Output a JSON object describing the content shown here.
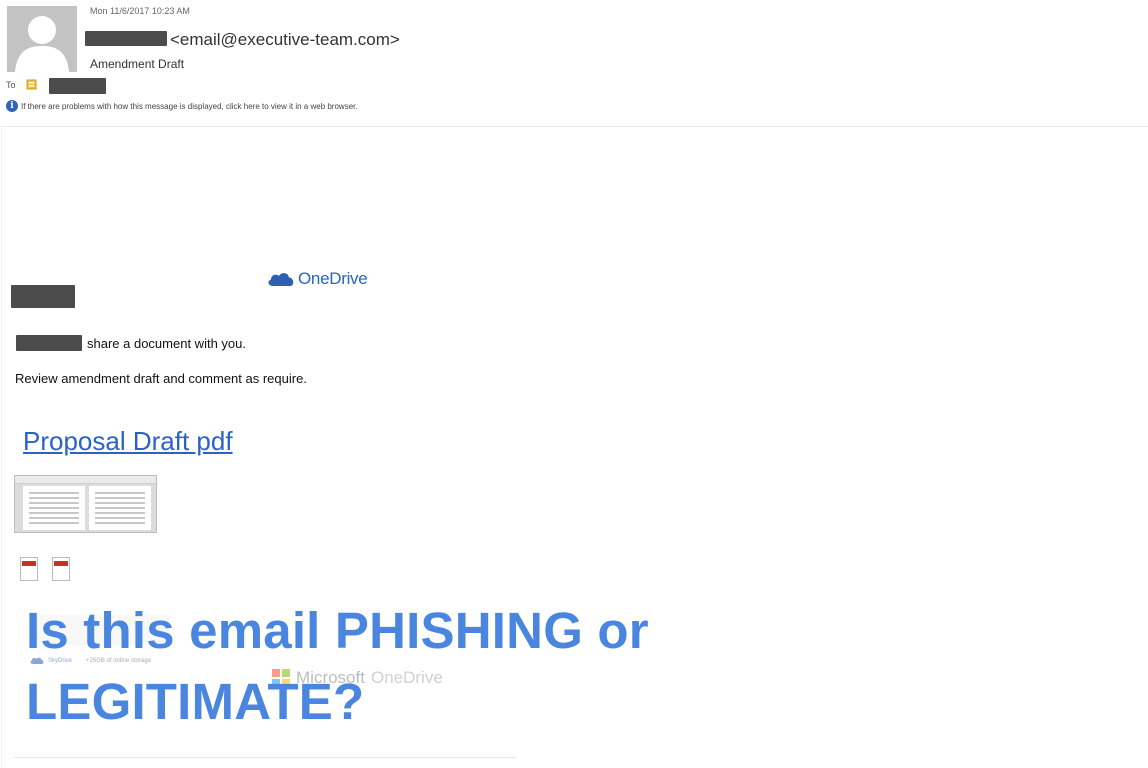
{
  "header": {
    "datetime": "Mon 11/6/2017 10:23 AM",
    "sender_email": "<email@executive-team.com>",
    "subject": "Amendment Draft",
    "to_label": "To",
    "info_text": "If there are problems with how this message is displayed, click here to view it in a web browser."
  },
  "body": {
    "brand": "OneDrive",
    "share_text": "share a document with you.",
    "instruction": "Review amendment draft and comment as require.",
    "document_link": "Proposal Draft pdf"
  },
  "footer": {
    "brand_small": "SkyDrive",
    "storage_text": "+25GB of online storage",
    "microsoft": "Microsoft",
    "onedrive": "OneDrive"
  },
  "overlay": {
    "line1": "Is this email PHISHING or",
    "line2": "LEGITIMATE?"
  },
  "colors": {
    "link": "#2a62c9",
    "brand": "#2766c2",
    "overlay": "#4a86e0",
    "redaction": "#4b4b4b"
  }
}
